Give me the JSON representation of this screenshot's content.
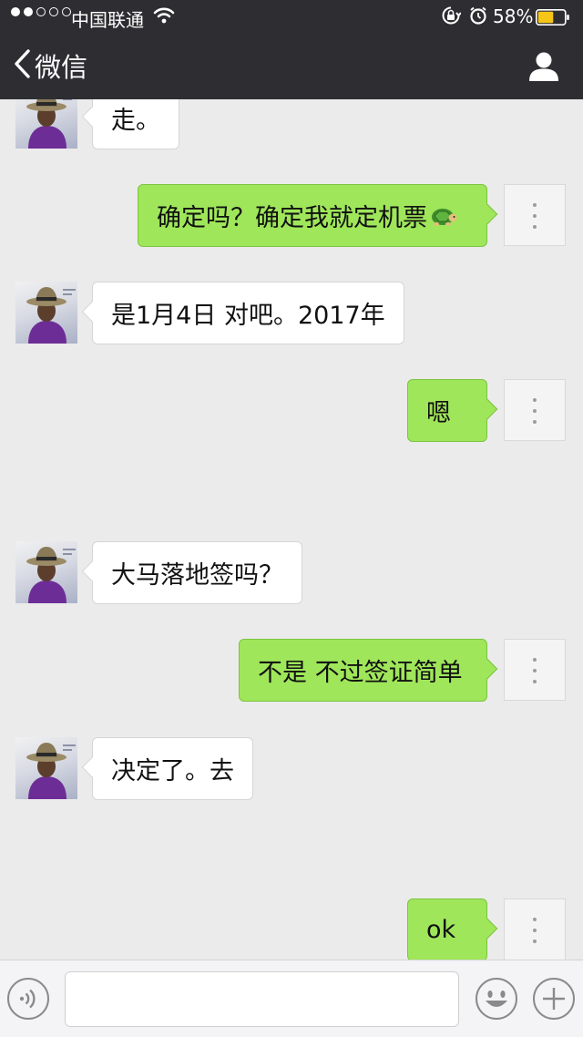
{
  "status_bar": {
    "carrier": "中国联通",
    "battery_percent": "58%",
    "signal_bars_filled": 2,
    "signal_bars_total": 5,
    "battery_level": 0.58
  },
  "nav": {
    "back_label": "微信",
    "back_icon": "chevron-left-icon",
    "profile_icon": "person-icon"
  },
  "messages": [
    {
      "side": "in",
      "text": "走。"
    },
    {
      "side": "out",
      "text": "确定吗？确定我就定机票",
      "emoji": "turtle-emoji"
    },
    {
      "side": "in",
      "text": "是1月4日 对吧。2017年"
    },
    {
      "side": "out",
      "text": "嗯"
    },
    {
      "side": "in",
      "text": "大马落地签吗？"
    },
    {
      "side": "out",
      "text": "不是 不过签证简单"
    },
    {
      "side": "in",
      "text": "决定了。去"
    },
    {
      "side": "out",
      "text": "ok"
    }
  ],
  "input_bar": {
    "text_value": "",
    "icons": [
      "voice-icon",
      "emoji-icon",
      "plus-icon"
    ]
  },
  "colors": {
    "header_bg": "#2e2e32",
    "chat_bg": "#ebebeb",
    "outgoing_bubble": "#9fe65a",
    "incoming_bubble": "#ffffff"
  }
}
